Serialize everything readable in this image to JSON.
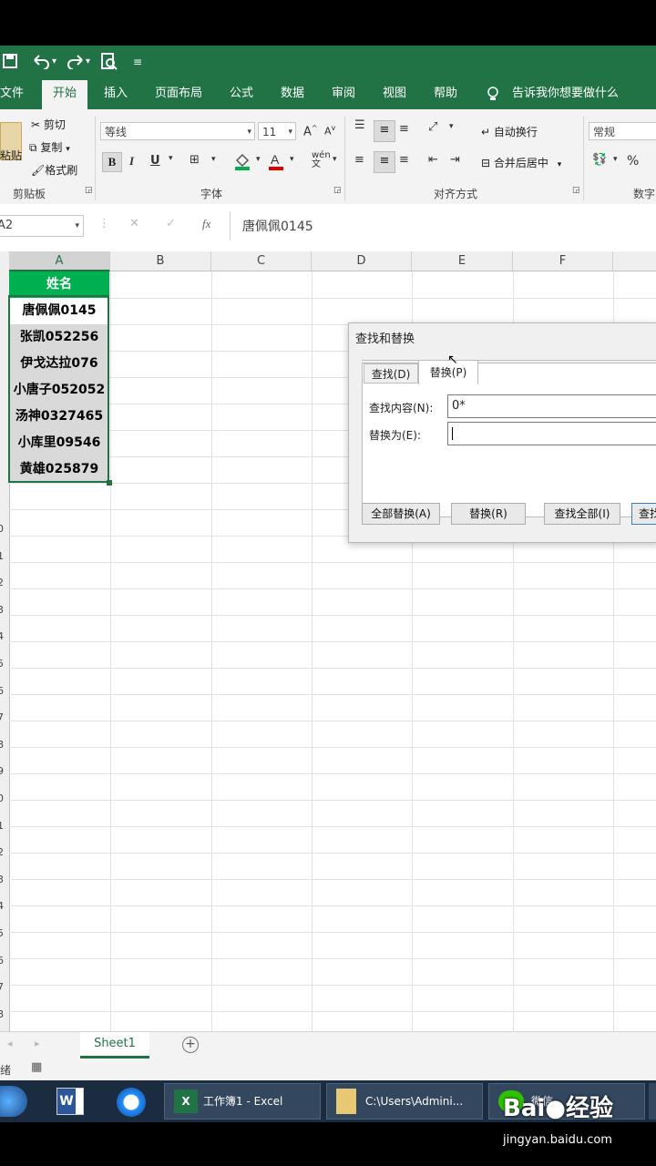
{
  "qat": {
    "save_icon": "save-icon",
    "undo_icon": "undo-icon",
    "redo_icon": "redo-icon",
    "preview_icon": "print-preview-icon",
    "more_icon": "customize-qat-icon"
  },
  "tabs": [
    "文件",
    "开始",
    "插入",
    "页面布局",
    "公式",
    "数据",
    "审阅",
    "视图",
    "帮助"
  ],
  "tell_me": "告诉我你想要做什么",
  "clipboard": {
    "paste": "粘贴",
    "cut": "剪切",
    "copy": "复制",
    "format_painter": "格式刷",
    "group": "剪贴板"
  },
  "font": {
    "name": "等线",
    "size": "11",
    "bold": "B",
    "italic": "I",
    "underline": "U",
    "group": "字体"
  },
  "alignment": {
    "wrap": "自动换行",
    "merge": "合并后居中",
    "group": "对齐方式"
  },
  "number": {
    "format": "常规",
    "percent": "%",
    "group": "数字"
  },
  "formula_bar": {
    "name_box": "A2",
    "fx": "fx",
    "content": "唐佩佩0145"
  },
  "columns": [
    "A",
    "B",
    "C",
    "D",
    "E",
    "F"
  ],
  "cells": {
    "header": "姓名",
    "names": [
      "唐佩佩0145",
      "张凯052256",
      "伊戈达拉076",
      "小唐子052052",
      "汤神0327465",
      "小库里09546",
      "黄雄025879"
    ]
  },
  "row_numbers": [
    "0",
    "1",
    "2",
    "3",
    "4",
    "5",
    "6",
    "7",
    "8",
    "9",
    "0",
    "1",
    "2",
    "3",
    "4",
    "5",
    "6",
    "7",
    "8"
  ],
  "dialog": {
    "title": "查找和替换",
    "tab_find": "查找(D)",
    "tab_replace": "替换(P)",
    "find_label": "查找内容(N):",
    "find_value": "0*",
    "replace_label": "替换为(E):",
    "replace_value": "",
    "btn_replace_all": "全部替换(A)",
    "btn_replace": "替换(R)",
    "btn_find_all": "查找全部(I)",
    "btn_find_next": "查找"
  },
  "sheet": {
    "tab": "Sheet1",
    "add": "+"
  },
  "status": {
    "ready": "绪"
  },
  "taskbar": {
    "excel": "工作簿1 - Excel",
    "explorer": "C:\\Users\\Admini...",
    "wechat": "微信"
  },
  "watermark": {
    "brand": "Bai",
    "brand2": "经验",
    "url": "jingyan.baidu.com"
  },
  "colors": {
    "excel_green": "#217346",
    "header_fill": "#00b050",
    "selected_fill": "#d9d9d9"
  }
}
